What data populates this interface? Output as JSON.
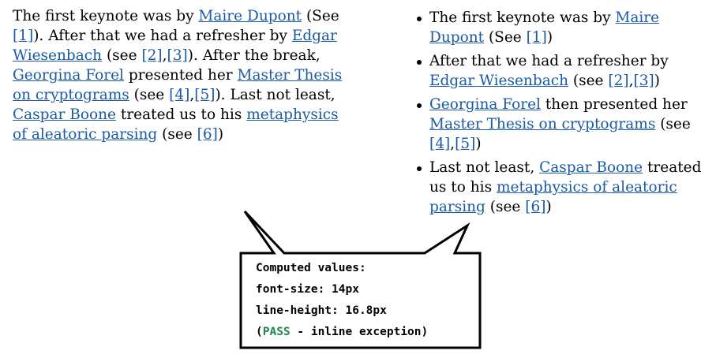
{
  "paragraph": {
    "p1": "The first keynote was by ",
    "a1": "Maire Dupont",
    "p2": " (See ",
    "r1": "[1]",
    "p3": "). After that we had a refresher by ",
    "a2": "Edgar Wiesenbach",
    "p4": " (see ",
    "r2": "[2]",
    "p5": ",",
    "r3": "[3]",
    "p6": "). After the break, ",
    "a3": "Georgina Forel",
    "p7": " presented her ",
    "a4": "Master Thesis on cryptograms",
    "p8": " (see ",
    "r4": "[4]",
    "p9": ",",
    "r5": "[5]",
    "p10": "). Last not least, ",
    "a5": "Caspar Boone",
    "p11": " treated us to his ",
    "a6": "metaphysics of aleatoric parsing",
    "p12": " (see ",
    "r6": "[6]",
    "p13": ")"
  },
  "bullets": [
    {
      "t1": "The first keynote was by ",
      "link": "Maire Dupont",
      "t2": " (See ",
      "r1": "[1]",
      "t3": ")"
    },
    {
      "t1": "After that we had a refresher by ",
      "link": "Edgar Wiesenbach",
      "t2": " (see ",
      "r1": "[2]",
      "sep": ",",
      "r2": "[3]",
      "t3": ")"
    },
    {
      "link1": "Georgina Forel",
      "t1": " then presented her ",
      "link2": "Master Thesis on cryptograms",
      "t2": " (see ",
      "r1": "[4]",
      "sep": ",",
      "r2": "[5]",
      "t3": ")"
    },
    {
      "t1": "Last not least, ",
      "link1": "Caspar Boone",
      "t2": " treated us to his ",
      "link2": "metaphysics of aleatoric parsing",
      "t3": " (see ",
      "r1": "[6]",
      "t4": ")"
    }
  ],
  "callout": {
    "line1": "Computed values:",
    "line2": "font-size: 14px",
    "line3": "line-height: 16.8px",
    "open": "(",
    "pass": "PASS",
    "rest": " - inline exception)",
    "pass_color": "#22884a"
  },
  "colors": {
    "link": "#1a5aa6",
    "text": "#000000"
  }
}
